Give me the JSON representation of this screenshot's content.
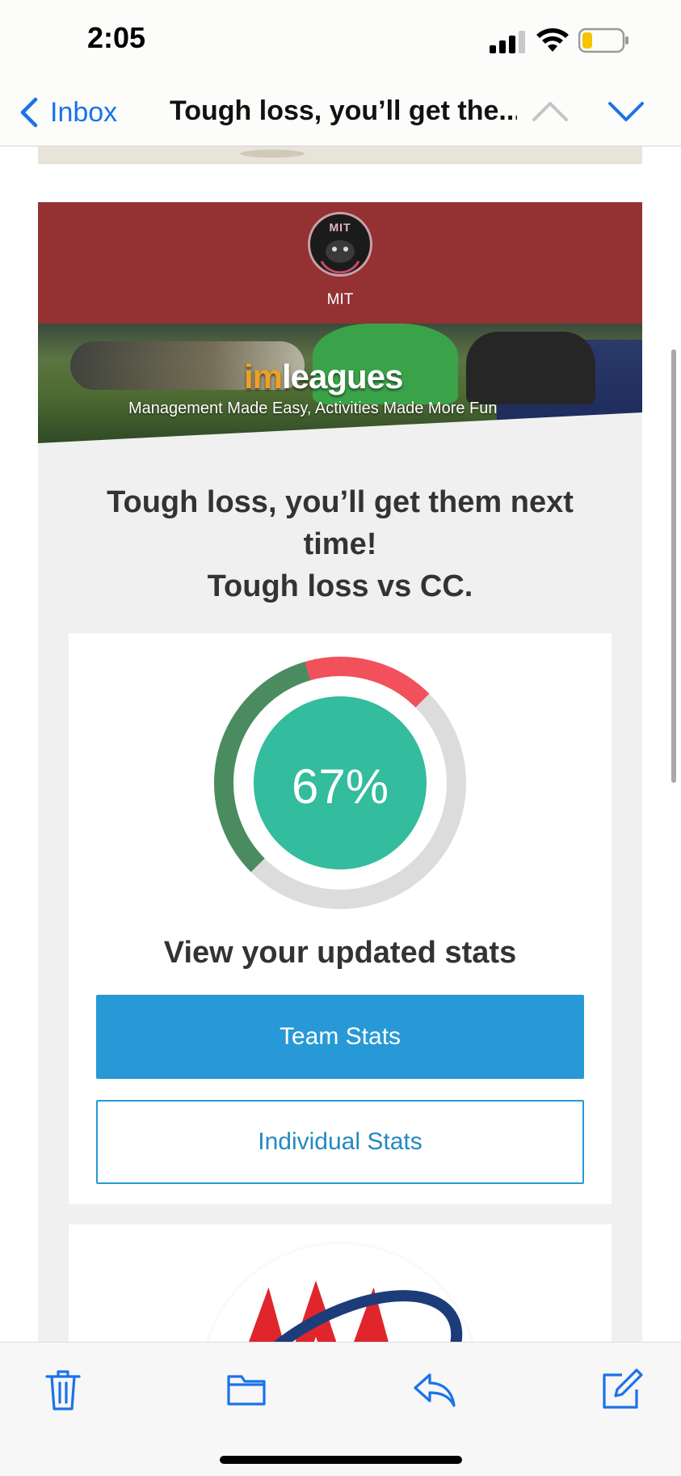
{
  "status_bar": {
    "time": "2:05",
    "icons": [
      "cellular-signal-icon",
      "wifi-icon",
      "battery-low-icon"
    ]
  },
  "nav": {
    "back_label": "Inbox",
    "subject_title": "Tough loss, you’ll get the...",
    "icons": [
      "chevron-left-icon",
      "chevron-up-icon",
      "chevron-down-icon"
    ]
  },
  "email": {
    "org_name": "MIT",
    "org_logo_text": "MIT",
    "banner": {
      "logo_prefix": "im",
      "logo_suffix": "leagues",
      "tagline": "Management Made Easy, Activities Made More Fun"
    },
    "headline": "Tough loss, you’ll get them next time!",
    "subheadline": "Tough loss vs CC.",
    "stats": {
      "percent_label": "67%",
      "win_rate": 0.67,
      "ring_segments": {
        "wins_fraction": 0.33,
        "losses_fraction": 0.17,
        "remaining_fraction": 0.5
      },
      "heading": "View your updated stats",
      "team_button": "Team Stats",
      "individual_button": "Individual Stats"
    }
  },
  "colors": {
    "link_blue": "#1a73e8",
    "header_red": "#943132",
    "button_blue": "#2699d6",
    "donut_center": "#33bc9d",
    "donut_green": "#4a8c60",
    "donut_red": "#f2505a",
    "donut_grey": "#dcdcdc"
  },
  "toolbar": {
    "icons": [
      "trash-icon",
      "folder-icon",
      "reply-icon",
      "compose-icon"
    ]
  }
}
